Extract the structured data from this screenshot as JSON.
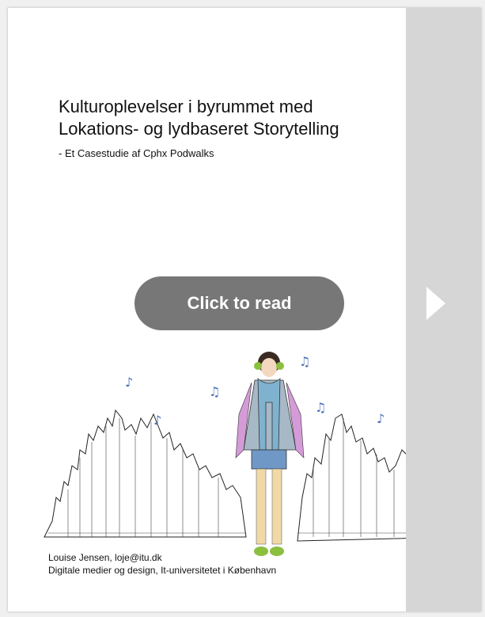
{
  "document": {
    "title_line1": "Kulturoplevelser i byrummet med",
    "title_line2": "Lokations- og lydbaseret Storytelling",
    "subtitle": "- Et Casestudie af Cphx Podwalks",
    "author": "Louise Jensen, loje@itu.dk",
    "affiliation": "Digitale medier og design, It-universitetet i København"
  },
  "overlay": {
    "read_button_label": "Click to read"
  },
  "icons": {
    "next": "play-arrow-icon",
    "notes": "music-note-icon"
  },
  "colors": {
    "button_bg": "#777777",
    "page_bg": "#ffffff",
    "side_strip": "#d6d6d6",
    "notes": "#4a6fb6",
    "scarf": "#7fb2cf"
  }
}
